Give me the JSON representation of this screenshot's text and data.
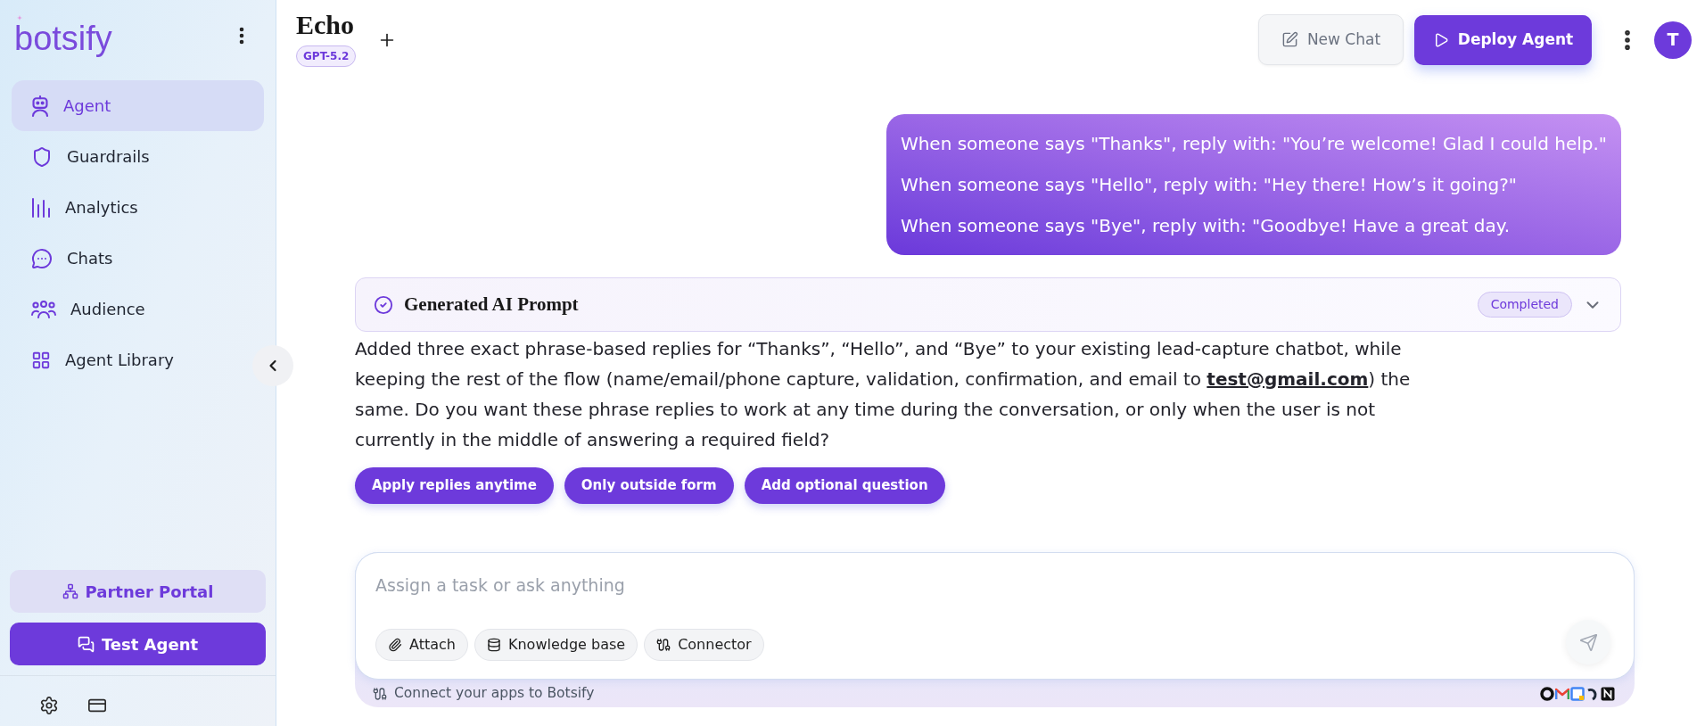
{
  "sidebar": {
    "logo": "botsify",
    "nav": [
      {
        "label": "Agent",
        "selected": true
      },
      {
        "label": "Guardrails",
        "selected": false
      },
      {
        "label": "Analytics",
        "selected": false
      },
      {
        "label": "Chats",
        "selected": false
      },
      {
        "label": "Audience",
        "selected": false
      },
      {
        "label": "Agent Library",
        "selected": false
      }
    ],
    "actions": [
      {
        "kind": "secondary",
        "label": "Partner Portal"
      },
      {
        "kind": "primary",
        "label": "Test Agent"
      }
    ]
  },
  "header": {
    "title": "Echo",
    "model": "GPT-5.2",
    "actions": [
      {
        "kind": "secondary",
        "label": "New Chat"
      },
      {
        "kind": "primary",
        "label": "Deploy Agent"
      }
    ],
    "avatar": "T"
  },
  "messages": [
    {
      "kind": "user",
      "lines": [
        "When someone says \"Thanks\", reply with: \"You’re welcome! Glad I could help.\"",
        "When someone says \"Hello\", reply with: \"Hey there! How’s it going?\"",
        "When someone says \"Bye\", reply with: \"Goodbye! Have a great day."
      ]
    },
    {
      "kind": "prompt_card",
      "title": "Generated AI Prompt",
      "status": "Completed"
    },
    {
      "kind": "assistant",
      "before": "Added three exact phrase-based replies for “Thanks”, “Hello”, and “Bye” to your existing lead-capture chatbot, while keeping the rest of the flow (name/email/phone capture, validation, confirmation, and email to ",
      "link": "test@gmail.com",
      "after": ") the same. Do you want these phrase replies to work at any time during the conversation, or only when the user is not currently in the middle of answering a required field?",
      "suggestions": [
        "Apply replies anytime",
        "Only outside form",
        "Add optional question"
      ]
    }
  ],
  "composer": {
    "placeholder": "Assign a task or ask anything",
    "tools": [
      "Attach",
      "Knowledge base",
      "Connector"
    ],
    "note": "Connect your apps to Botsify"
  }
}
